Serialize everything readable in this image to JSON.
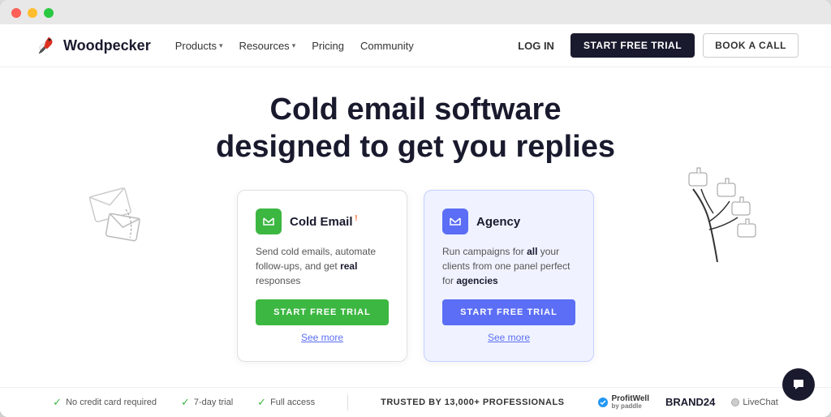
{
  "browser": {
    "traffic_lights": [
      "red",
      "yellow",
      "green"
    ]
  },
  "nav": {
    "logo_text": "Woodpecker",
    "links": [
      {
        "label": "Products",
        "has_dropdown": true
      },
      {
        "label": "Resources",
        "has_dropdown": true
      },
      {
        "label": "Pricing",
        "has_dropdown": false
      },
      {
        "label": "Community",
        "has_dropdown": false
      }
    ],
    "login_label": "LOG IN",
    "start_trial_label": "START FREE TRIAL",
    "book_call_label": "BOOK A CALL"
  },
  "hero": {
    "title_line1": "Cold email software",
    "title_line2": "designed to get you replies"
  },
  "cards": [
    {
      "id": "cold-email",
      "title": "Cold Email",
      "badge": "1",
      "description": "Send cold emails, automate follow-ups, and get real responses",
      "btn_label": "START FREE TRIAL",
      "see_more_label": "See more",
      "icon_type": "green"
    },
    {
      "id": "agency",
      "title": "Agency",
      "badge": "",
      "description": "Run campaigns for all your clients from one panel perfect for agencies",
      "btn_label": "START FREE TRIAL",
      "see_more_label": "See more",
      "icon_type": "blue"
    }
  ],
  "trust_badges": [
    {
      "label": "No credit card required"
    },
    {
      "label": "7-day trial"
    },
    {
      "label": "Full access"
    }
  ],
  "trusted": {
    "label": "TRUSTED BY 13,000+ PROFESSIONALS"
  },
  "brand_logos": [
    {
      "label": "ProfitWell",
      "sublabel": "by paddle"
    },
    {
      "label": "BRAND24"
    },
    {
      "label": "LiveChat"
    }
  ]
}
